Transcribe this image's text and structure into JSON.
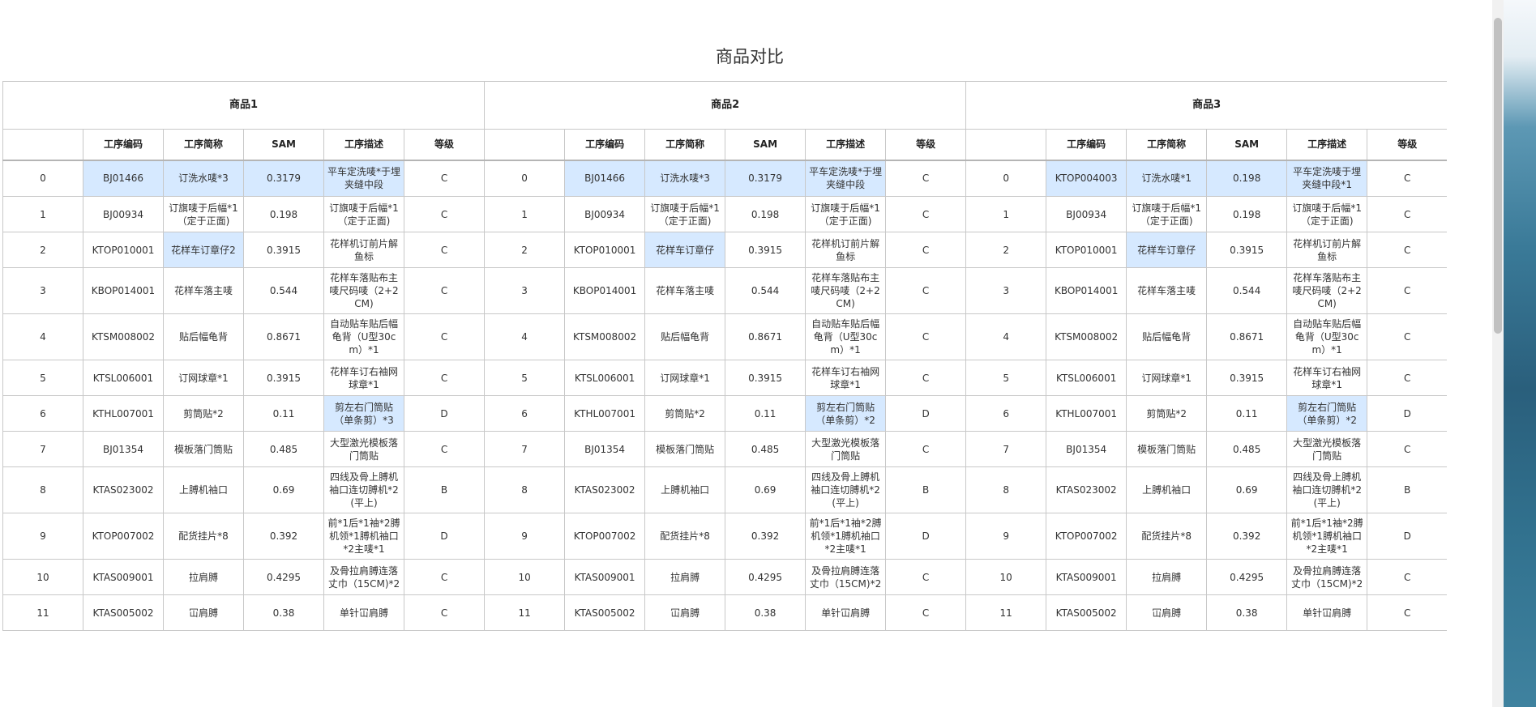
{
  "page_title": "商品对比",
  "groups": [
    "商品1",
    "商品2",
    "商品3"
  ],
  "columns": [
    "",
    "工序编码",
    "工序简称",
    "SAM",
    "工序描述",
    "等级"
  ],
  "products": [
    {
      "rows": [
        {
          "idx": "0",
          "code": "BJ01466",
          "name": "订洗水唛*3",
          "sam": "0.3179",
          "desc": "平车定洗唛*于埋夹缝中段",
          "grade": "C",
          "hl": [
            "code",
            "name",
            "sam",
            "desc"
          ]
        },
        {
          "idx": "1",
          "code": "BJ00934",
          "name": "订旗唛于后幅*1（定于正面)",
          "sam": "0.198",
          "desc": "订旗唛于后幅*1（定于正面)",
          "grade": "C",
          "hl": []
        },
        {
          "idx": "2",
          "code": "KTOP010001",
          "name": "花样车订章仔2",
          "sam": "0.3915",
          "desc": "花样机订前片解鱼标",
          "grade": "C",
          "hl": [
            "name"
          ]
        },
        {
          "idx": "3",
          "code": "KBOP014001",
          "name": "花样车落主唛",
          "sam": "0.544",
          "desc": "花样车落贴布主唛尺码唛（2+2CM)",
          "grade": "C",
          "hl": []
        },
        {
          "idx": "4",
          "code": "KTSM008002",
          "name": "贴后幅龟背",
          "sam": "0.8671",
          "desc": "自动贴车贴后幅龟背（U型30cm）*1",
          "grade": "C",
          "hl": []
        },
        {
          "idx": "5",
          "code": "KTSL006001",
          "name": "订网球章*1",
          "sam": "0.3915",
          "desc": "花样车订右袖网球章*1",
          "grade": "C",
          "hl": []
        },
        {
          "idx": "6",
          "code": "KTHL007001",
          "name": "剪筒贴*2",
          "sam": "0.11",
          "desc": "剪左右门筒贴（单条剪）*3",
          "grade": "D",
          "hl": [
            "desc"
          ]
        },
        {
          "idx": "7",
          "code": "BJ01354",
          "name": "模板落门筒贴",
          "sam": "0.485",
          "desc": "大型激光模板落门筒贴",
          "grade": "C",
          "hl": []
        },
        {
          "idx": "8",
          "code": "KTAS023002",
          "name": "上膊机袖口",
          "sam": "0.69",
          "desc": "四线及骨上膊机袖口连切膊机*2(平上)",
          "grade": "B",
          "hl": []
        },
        {
          "idx": "9",
          "code": "KTOP007002",
          "name": "配货挂片*8",
          "sam": "0.392",
          "desc": "前*1后*1袖*2膊机领*1膊机袖口*2主唛*1",
          "grade": "D",
          "hl": []
        },
        {
          "idx": "10",
          "code": "KTAS009001",
          "name": "拉肩膊",
          "sam": "0.4295",
          "desc": "及骨拉肩膊连落丈巾（15CM)*2",
          "grade": "C",
          "hl": []
        },
        {
          "idx": "11",
          "code": "KTAS005002",
          "name": "冚肩膊",
          "sam": "0.38",
          "desc": "单针冚肩膊",
          "grade": "C",
          "hl": []
        }
      ]
    },
    {
      "rows": [
        {
          "idx": "0",
          "code": "BJ01466",
          "name": "订洗水唛*3",
          "sam": "0.3179",
          "desc": "平车定洗唛*于埋夹缝中段",
          "grade": "C",
          "hl": [
            "code",
            "name",
            "sam",
            "desc"
          ]
        },
        {
          "idx": "1",
          "code": "BJ00934",
          "name": "订旗唛于后幅*1（定于正面)",
          "sam": "0.198",
          "desc": "订旗唛于后幅*1（定于正面)",
          "grade": "C",
          "hl": []
        },
        {
          "idx": "2",
          "code": "KTOP010001",
          "name": "花样车订章仔",
          "sam": "0.3915",
          "desc": "花样机订前片解鱼标",
          "grade": "C",
          "hl": [
            "name"
          ]
        },
        {
          "idx": "3",
          "code": "KBOP014001",
          "name": "花样车落主唛",
          "sam": "0.544",
          "desc": "花样车落贴布主唛尺码唛（2+2CM)",
          "grade": "C",
          "hl": []
        },
        {
          "idx": "4",
          "code": "KTSM008002",
          "name": "贴后幅龟背",
          "sam": "0.8671",
          "desc": "自动贴车贴后幅龟背（U型30cm）*1",
          "grade": "C",
          "hl": []
        },
        {
          "idx": "5",
          "code": "KTSL006001",
          "name": "订网球章*1",
          "sam": "0.3915",
          "desc": "花样车订右袖网球章*1",
          "grade": "C",
          "hl": []
        },
        {
          "idx": "6",
          "code": "KTHL007001",
          "name": "剪筒贴*2",
          "sam": "0.11",
          "desc": "剪左右门筒贴（单条剪）*2",
          "grade": "D",
          "hl": [
            "desc"
          ]
        },
        {
          "idx": "7",
          "code": "BJ01354",
          "name": "模板落门筒贴",
          "sam": "0.485",
          "desc": "大型激光模板落门筒贴",
          "grade": "C",
          "hl": []
        },
        {
          "idx": "8",
          "code": "KTAS023002",
          "name": "上膊机袖口",
          "sam": "0.69",
          "desc": "四线及骨上膊机袖口连切膊机*2(平上)",
          "grade": "B",
          "hl": []
        },
        {
          "idx": "9",
          "code": "KTOP007002",
          "name": "配货挂片*8",
          "sam": "0.392",
          "desc": "前*1后*1袖*2膊机领*1膊机袖口*2主唛*1",
          "grade": "D",
          "hl": []
        },
        {
          "idx": "10",
          "code": "KTAS009001",
          "name": "拉肩膊",
          "sam": "0.4295",
          "desc": "及骨拉肩膊连落丈巾（15CM)*2",
          "grade": "C",
          "hl": []
        },
        {
          "idx": "11",
          "code": "KTAS005002",
          "name": "冚肩膊",
          "sam": "0.38",
          "desc": "单针冚肩膊",
          "grade": "C",
          "hl": []
        }
      ]
    },
    {
      "rows": [
        {
          "idx": "0",
          "code": "KTOP004003",
          "name": "订洗水唛*1",
          "sam": "0.198",
          "desc": "平车定洗唛于埋夹缝中段*1",
          "grade": "C",
          "hl": [
            "code",
            "name",
            "sam",
            "desc"
          ]
        },
        {
          "idx": "1",
          "code": "BJ00934",
          "name": "订旗唛于后幅*1（定于正面)",
          "sam": "0.198",
          "desc": "订旗唛于后幅*1（定于正面)",
          "grade": "C",
          "hl": []
        },
        {
          "idx": "2",
          "code": "KTOP010001",
          "name": "花样车订章仔",
          "sam": "0.3915",
          "desc": "花样机订前片解鱼标",
          "grade": "C",
          "hl": [
            "name"
          ]
        },
        {
          "idx": "3",
          "code": "KBOP014001",
          "name": "花样车落主唛",
          "sam": "0.544",
          "desc": "花样车落贴布主唛尺码唛（2+2CM)",
          "grade": "C",
          "hl": []
        },
        {
          "idx": "4",
          "code": "KTSM008002",
          "name": "贴后幅龟背",
          "sam": "0.8671",
          "desc": "自动贴车贴后幅龟背（U型30cm）*1",
          "grade": "C",
          "hl": []
        },
        {
          "idx": "5",
          "code": "KTSL006001",
          "name": "订网球章*1",
          "sam": "0.3915",
          "desc": "花样车订右袖网球章*1",
          "grade": "C",
          "hl": []
        },
        {
          "idx": "6",
          "code": "KTHL007001",
          "name": "剪筒贴*2",
          "sam": "0.11",
          "desc": "剪左右门筒贴（单条剪）*2",
          "grade": "D",
          "hl": [
            "desc"
          ]
        },
        {
          "idx": "7",
          "code": "BJ01354",
          "name": "模板落门筒贴",
          "sam": "0.485",
          "desc": "大型激光模板落门筒贴",
          "grade": "C",
          "hl": []
        },
        {
          "idx": "8",
          "code": "KTAS023002",
          "name": "上膊机袖口",
          "sam": "0.69",
          "desc": "四线及骨上膊机袖口连切膊机*2(平上)",
          "grade": "B",
          "hl": []
        },
        {
          "idx": "9",
          "code": "KTOP007002",
          "name": "配货挂片*8",
          "sam": "0.392",
          "desc": "前*1后*1袖*2膊机领*1膊机袖口*2主唛*1",
          "grade": "D",
          "hl": []
        },
        {
          "idx": "10",
          "code": "KTAS009001",
          "name": "拉肩膊",
          "sam": "0.4295",
          "desc": "及骨拉肩膊连落丈巾（15CM)*2",
          "grade": "C",
          "hl": []
        },
        {
          "idx": "11",
          "code": "KTAS005002",
          "name": "冚肩膊",
          "sam": "0.38",
          "desc": "单针冚肩膊",
          "grade": "C",
          "hl": []
        }
      ]
    }
  ],
  "colors": {
    "highlight": "#d6e9ff",
    "border": "#c8c8c8"
  }
}
